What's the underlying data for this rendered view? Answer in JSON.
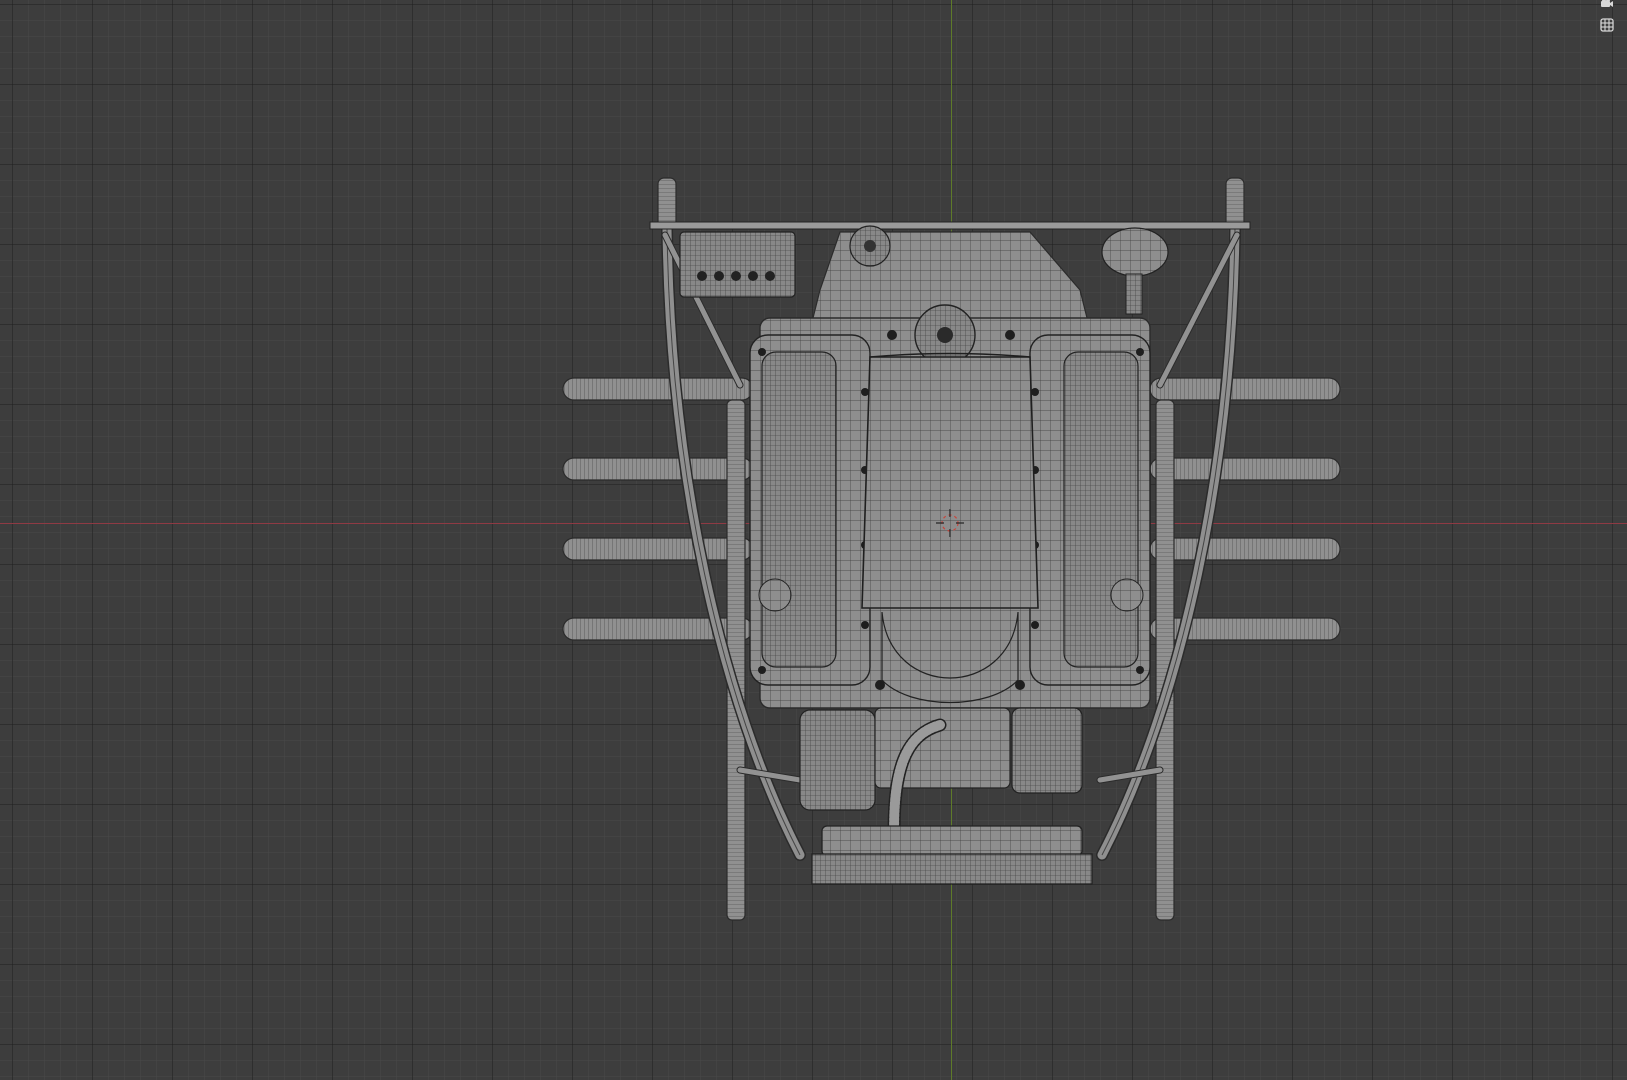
{
  "viewport": {
    "background": "#3d3d3d",
    "x_axis_color": "#8f3a44",
    "y_axis_color": "#5e7a2a",
    "wire_color": "#2a2a2a",
    "surface_color": "#8e8e8e"
  },
  "navigation": {
    "camera_icon": "camera-icon",
    "grid_icon": "grid-icon"
  }
}
